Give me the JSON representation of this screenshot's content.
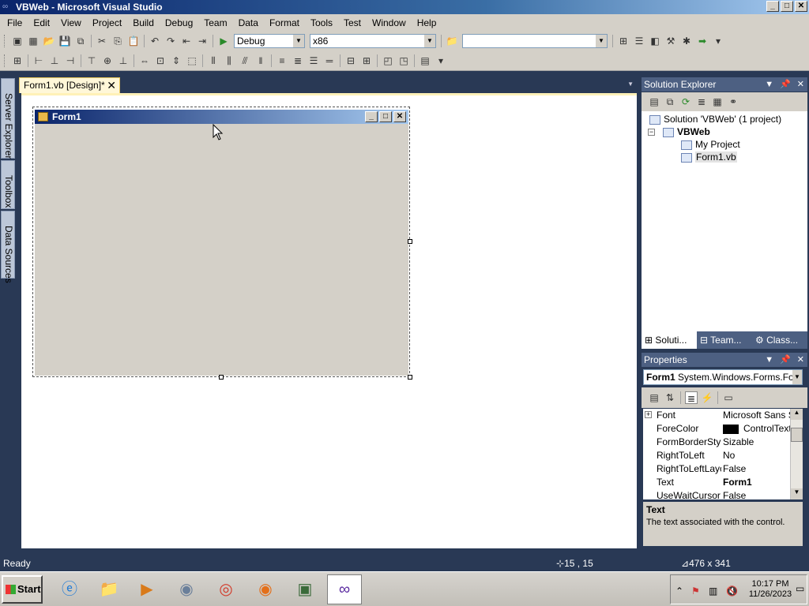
{
  "window": {
    "title": "VBWeb - Microsoft Visual Studio",
    "min": "_",
    "max": "□",
    "close": "✕"
  },
  "menu": [
    "File",
    "Edit",
    "View",
    "Project",
    "Build",
    "Debug",
    "Team",
    "Data",
    "Format",
    "Tools",
    "Test",
    "Window",
    "Help"
  ],
  "toolbar": {
    "config": "Debug",
    "platform": "x86",
    "find": ""
  },
  "side_tabs": [
    "Server Explorer",
    "Toolbox",
    "Data Sources"
  ],
  "document_tab": {
    "label": "Form1.vb [Design]*",
    "close": "✕"
  },
  "form": {
    "title": "Form1",
    "min": "_",
    "max": "□",
    "close": "✕"
  },
  "solution_explorer": {
    "title": "Solution Explorer",
    "tree": [
      {
        "label": "Solution 'VBWeb' (1 project)"
      },
      {
        "label": "VBWeb"
      },
      {
        "label": "My Project"
      },
      {
        "label": "Form1.vb"
      }
    ],
    "tabs": [
      "Soluti...",
      "Team...",
      "Class..."
    ]
  },
  "properties": {
    "title": "Properties",
    "object": "Form1",
    "object_type": "System.Windows.Forms.Form",
    "rows": [
      {
        "name": "Font",
        "value": "Microsoft Sans Serif"
      },
      {
        "name": "ForeColor",
        "value": "ControlText"
      },
      {
        "name": "FormBorderStyle",
        "value": "Sizable"
      },
      {
        "name": "RightToLeft",
        "value": "No"
      },
      {
        "name": "RightToLeftLayout",
        "value": "False"
      },
      {
        "name": "Text",
        "value": "Form1"
      },
      {
        "name": "UseWaitCursor",
        "value": "False"
      }
    ],
    "desc_title": "Text",
    "desc_text": "The text associated with the control."
  },
  "status": {
    "text": "Ready",
    "position": "15 , 15",
    "size": "476 x 341"
  },
  "taskbar": {
    "start": "Start",
    "time": "10:17 PM",
    "date": "11/26/2023"
  },
  "colors": {
    "ide_bg": "#293955",
    "panel_header": "#4d6082",
    "chrome": "#d4d0c8",
    "doc_tab": "#fff7d8"
  }
}
